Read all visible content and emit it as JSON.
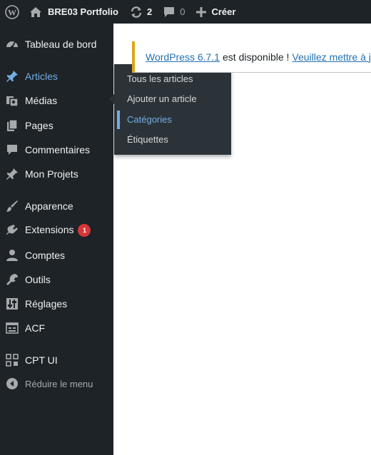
{
  "adminbar": {
    "site_name": "BRE03 Portfolio",
    "updates_count": "2",
    "comments_count": "0",
    "new_label": "Créer"
  },
  "sidebar": {
    "items": [
      {
        "label": "Tableau de bord",
        "icon": "dashboard-icon"
      },
      {
        "label": "Articles",
        "icon": "pin-icon",
        "active": true
      },
      {
        "label": "Médias",
        "icon": "media-icon"
      },
      {
        "label": "Pages",
        "icon": "pages-icon"
      },
      {
        "label": "Commentaires",
        "icon": "comment-icon"
      },
      {
        "label": "Mon Projets",
        "icon": "pin-icon"
      },
      {
        "label": "Apparence",
        "icon": "brush-icon"
      },
      {
        "label": "Extensions",
        "icon": "plugin-icon",
        "badge": "1"
      },
      {
        "label": "Comptes",
        "icon": "user-icon"
      },
      {
        "label": "Outils",
        "icon": "wrench-icon"
      },
      {
        "label": "Réglages",
        "icon": "settings-icon"
      },
      {
        "label": "ACF",
        "icon": "acf-icon"
      },
      {
        "label": "CPT UI",
        "icon": "cptui-icon"
      },
      {
        "label": "Réduire le menu",
        "icon": "collapse-icon"
      }
    ]
  },
  "submenu": {
    "items": [
      {
        "label": "Tous les articles"
      },
      {
        "label": "Ajouter un article"
      },
      {
        "label": "Catégories",
        "current": true
      },
      {
        "label": "Étiquettes"
      }
    ]
  },
  "notice": {
    "link1": "WordPress 6.7.1",
    "middle": "est disponible !",
    "link2": "Veuillez mettre à jour maintenant."
  },
  "colors": {
    "bar": "#1d2327",
    "accent": "#72aee6",
    "badge": "#d63638",
    "notice_border": "#dba617"
  }
}
